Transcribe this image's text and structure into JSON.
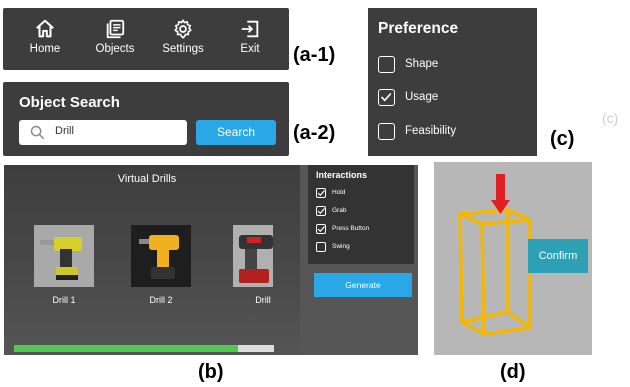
{
  "captions": {
    "a1": "(a-1)",
    "a2": "(a-2)",
    "b": "(b)",
    "c": "(c)",
    "c_ghost": "(c)",
    "d": "(d)"
  },
  "nav": {
    "items": [
      {
        "label": "Home",
        "icon": "home-icon"
      },
      {
        "label": "Objects",
        "icon": "objects-icon"
      },
      {
        "label": "Settings",
        "icon": "gear-icon"
      },
      {
        "label": "Exit",
        "icon": "exit-icon"
      }
    ]
  },
  "search": {
    "title": "Object Search",
    "value": "Drill",
    "button_label": "Search"
  },
  "preference": {
    "title": "Preference",
    "options": [
      {
        "label": "Shape",
        "checked": false
      },
      {
        "label": "Usage",
        "checked": true
      },
      {
        "label": "Feasibility",
        "checked": false
      }
    ]
  },
  "drills": {
    "title": "Virtual Drills",
    "items": [
      {
        "label": "Drill 1"
      },
      {
        "label": "Drill 2"
      },
      {
        "label": "Drill"
      }
    ],
    "progress": 0.86
  },
  "interactions": {
    "title": "Interactions",
    "options": [
      {
        "label": "Hold",
        "checked": true
      },
      {
        "label": "Grab",
        "checked": true
      },
      {
        "label": "Press Button",
        "checked": true
      },
      {
        "label": "Swing",
        "checked": false
      }
    ],
    "generate_label": "Generate"
  },
  "confirm": {
    "label": "Confirm"
  },
  "colors": {
    "accent": "#2aa7e6",
    "panel": "#3d3d3d",
    "progress": "#4fc94f",
    "wireframe": "#f5b800",
    "arrow": "#e02020",
    "confirm": "#2ea0b5"
  }
}
